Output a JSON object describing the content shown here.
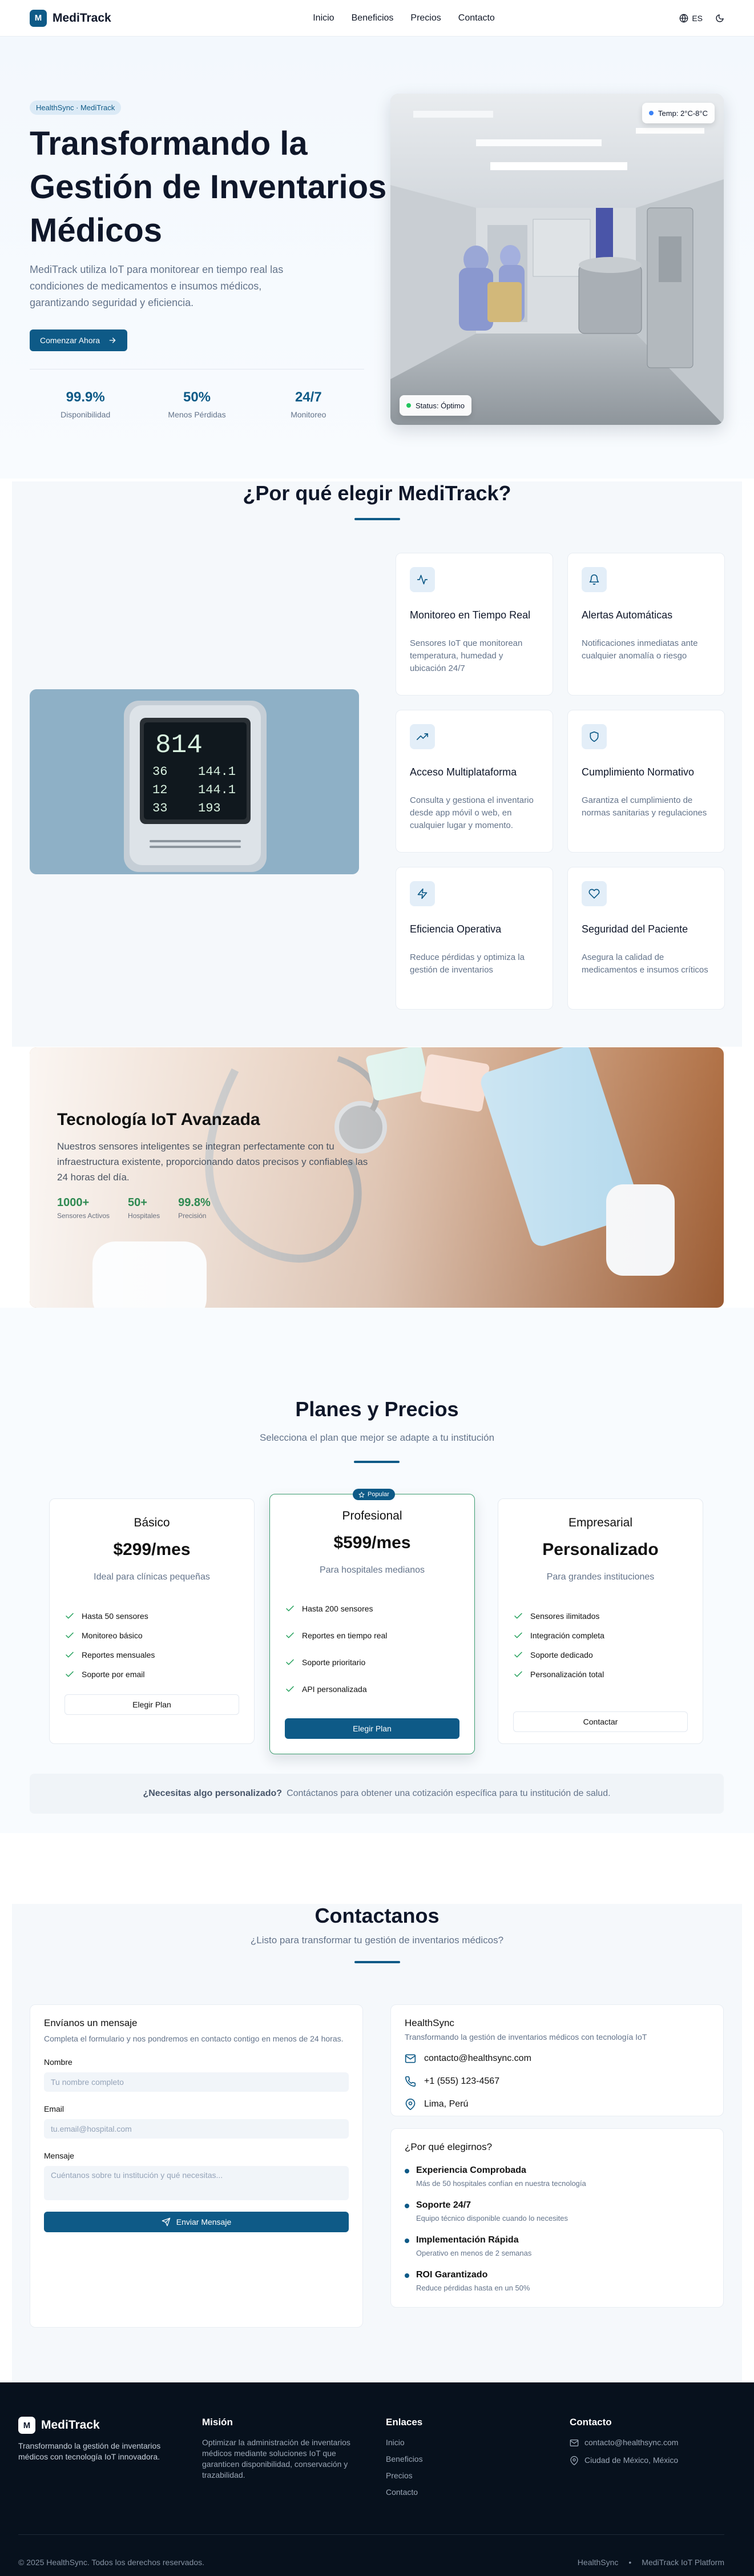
{
  "nav": {
    "brand": "MediTrack",
    "logo_letter": "M",
    "links": [
      "Inicio",
      "Beneficios",
      "Precios",
      "Contacto"
    ],
    "lang": "ES"
  },
  "hero": {
    "badge": "HealthSync · MediTrack",
    "title": "Transformando la Gestión de Inventarios Médicos",
    "text": "MediTrack utiliza IoT para monitorear en tiempo real las condiciones de medicamentos e insumos médicos, garantizando seguridad y eficiencia.",
    "cta": "Comenzar Ahora",
    "stats": [
      {
        "value": "99.9%",
        "label": "Disponibilidad"
      },
      {
        "value": "50%",
        "label": "Menos Pérdidas"
      },
      {
        "value": "24/7",
        "label": "Monitoreo"
      }
    ],
    "temp_pill": "Temp: 2°C-8°C",
    "status_pill": "Status: Óptimo"
  },
  "features": {
    "title": "¿Por qué elegir MediTrack?",
    "monitor_readings": [
      "814",
      "36",
      "144.1",
      "12",
      "144.1",
      "33",
      "193"
    ],
    "cards": [
      {
        "icon": "activity-icon",
        "title": "Monitoreo en Tiempo Real",
        "text": "Sensores IoT que monitorean temperatura, humedad y ubicación 24/7"
      },
      {
        "icon": "bell-icon",
        "title": "Alertas Automáticas",
        "text": "Notificaciones inmediatas ante cualquier anomalía o riesgo"
      },
      {
        "icon": "trending-up-icon",
        "title": "Acceso Multiplataforma",
        "text": "Consulta y gestiona el inventario desde app móvil o web, en cualquier lugar y momento."
      },
      {
        "icon": "shield-icon",
        "title": "Cumplimiento Normativo",
        "text": "Garantiza el cumplimiento de normas sanitarias y regulaciones"
      },
      {
        "icon": "zap-icon",
        "title": "Eficiencia Operativa",
        "text": "Reduce pérdidas y optimiza la gestión de inventarios"
      },
      {
        "icon": "heart-icon",
        "title": "Seguridad del Paciente",
        "text": "Asegura la calidad de medicamentos e insumos críticos"
      }
    ]
  },
  "iot": {
    "title": "Tecnología IoT Avanzada",
    "text": "Nuestros sensores inteligentes se integran perfectamente con tu infraestructura existente, proporcionando datos precisos y confiables las 24 horas del día.",
    "stats": [
      {
        "value": "1000+",
        "label": "Sensores Activos"
      },
      {
        "value": "50+",
        "label": "Hospitales"
      },
      {
        "value": "99.8%",
        "label": "Precisión"
      }
    ]
  },
  "pricing": {
    "title": "Planes y Precios",
    "subtitle": "Selecciona el plan que mejor se adapte a tu institución",
    "popular_tag": "Popular",
    "plans": [
      {
        "name": "Básico",
        "price": "$299/mes",
        "desc": "Ideal para clínicas pequeñas",
        "features": [
          "Hasta 50 sensores",
          "Monitoreo básico",
          "Reportes mensuales",
          "Soporte por email"
        ],
        "button": "Elegir Plan"
      },
      {
        "name": "Profesional",
        "price": "$599/mes",
        "desc": "Para hospitales medianos",
        "features": [
          "Hasta 200 sensores",
          "Reportes en tiempo real",
          "Soporte prioritario",
          "API personalizada"
        ],
        "button": "Elegir Plan"
      },
      {
        "name": "Empresarial",
        "price": "Personalizado",
        "desc": "Para grandes instituciones",
        "features": [
          "Sensores ilimitados",
          "Integración completa",
          "Soporte dedicado",
          "Personalización total"
        ],
        "button": "Contactar"
      }
    ],
    "custom_bold": "¿Necesitas algo personalizado?",
    "custom_text": "Contáctanos para obtener una cotización específica para tu institución de salud."
  },
  "contact": {
    "title": "Contactanos",
    "subtitle": "¿Listo para transformar tu gestión de inventarios médicos?",
    "form": {
      "title": "Envíanos un mensaje",
      "desc": "Completa el formulario y nos pondremos en contacto contigo en menos de 24 horas.",
      "name_label": "Nombre",
      "name_ph": "Tu nombre completo",
      "email_label": "Email",
      "email_ph": "tu.email@hospital.com",
      "msg_label": "Mensaje",
      "msg_ph": "Cuéntanos sobre tu institución y qué necesitas...",
      "submit": "Enviar Mensaje"
    },
    "info": {
      "title": "HealthSync",
      "desc": "Transformando la gestión de inventarios médicos con tecnología IoT",
      "email": "contacto@healthsync.com",
      "phone": "+1 (555) 123-4567",
      "location": "Lima, Perú"
    },
    "why": {
      "title": "¿Por qué elegirnos?",
      "items": [
        {
          "title": "Experiencia Comprobada",
          "text": "Más de 50 hospitales confían en nuestra tecnología"
        },
        {
          "title": "Soporte 24/7",
          "text": "Equipo técnico disponible cuando lo necesites"
        },
        {
          "title": "Implementación Rápida",
          "text": "Operativo en menos de 2 semanas"
        },
        {
          "title": "ROI Garantizado",
          "text": "Reduce pérdidas hasta en un 50%"
        }
      ]
    }
  },
  "footer": {
    "brand": "MediTrack",
    "logo_letter": "M",
    "tagline": "Transformando la gestión de inventarios médicos con tecnología IoT innovadora.",
    "mission_title": "Misión",
    "mission": "Optimizar la administración de inventarios médicos mediante soluciones IoT que garanticen disponibilidad, conservación y trazabilidad.",
    "links_title": "Enlaces",
    "links": [
      "Inicio",
      "Beneficios",
      "Precios",
      "Contacto"
    ],
    "contact_title": "Contacto",
    "email": "contacto@healthsync.com",
    "location": "Ciudad de México, México",
    "copyright": "© 2025 HealthSync. Todos los derechos reservados.",
    "bottom_right_1": "HealthSync",
    "bottom_sep": "•",
    "bottom_right_2": "MediTrack IoT Platform"
  },
  "colors": {
    "primary": "#0e5a87",
    "accent_green": "#2f8a52",
    "footer_bg": "#07111d"
  }
}
